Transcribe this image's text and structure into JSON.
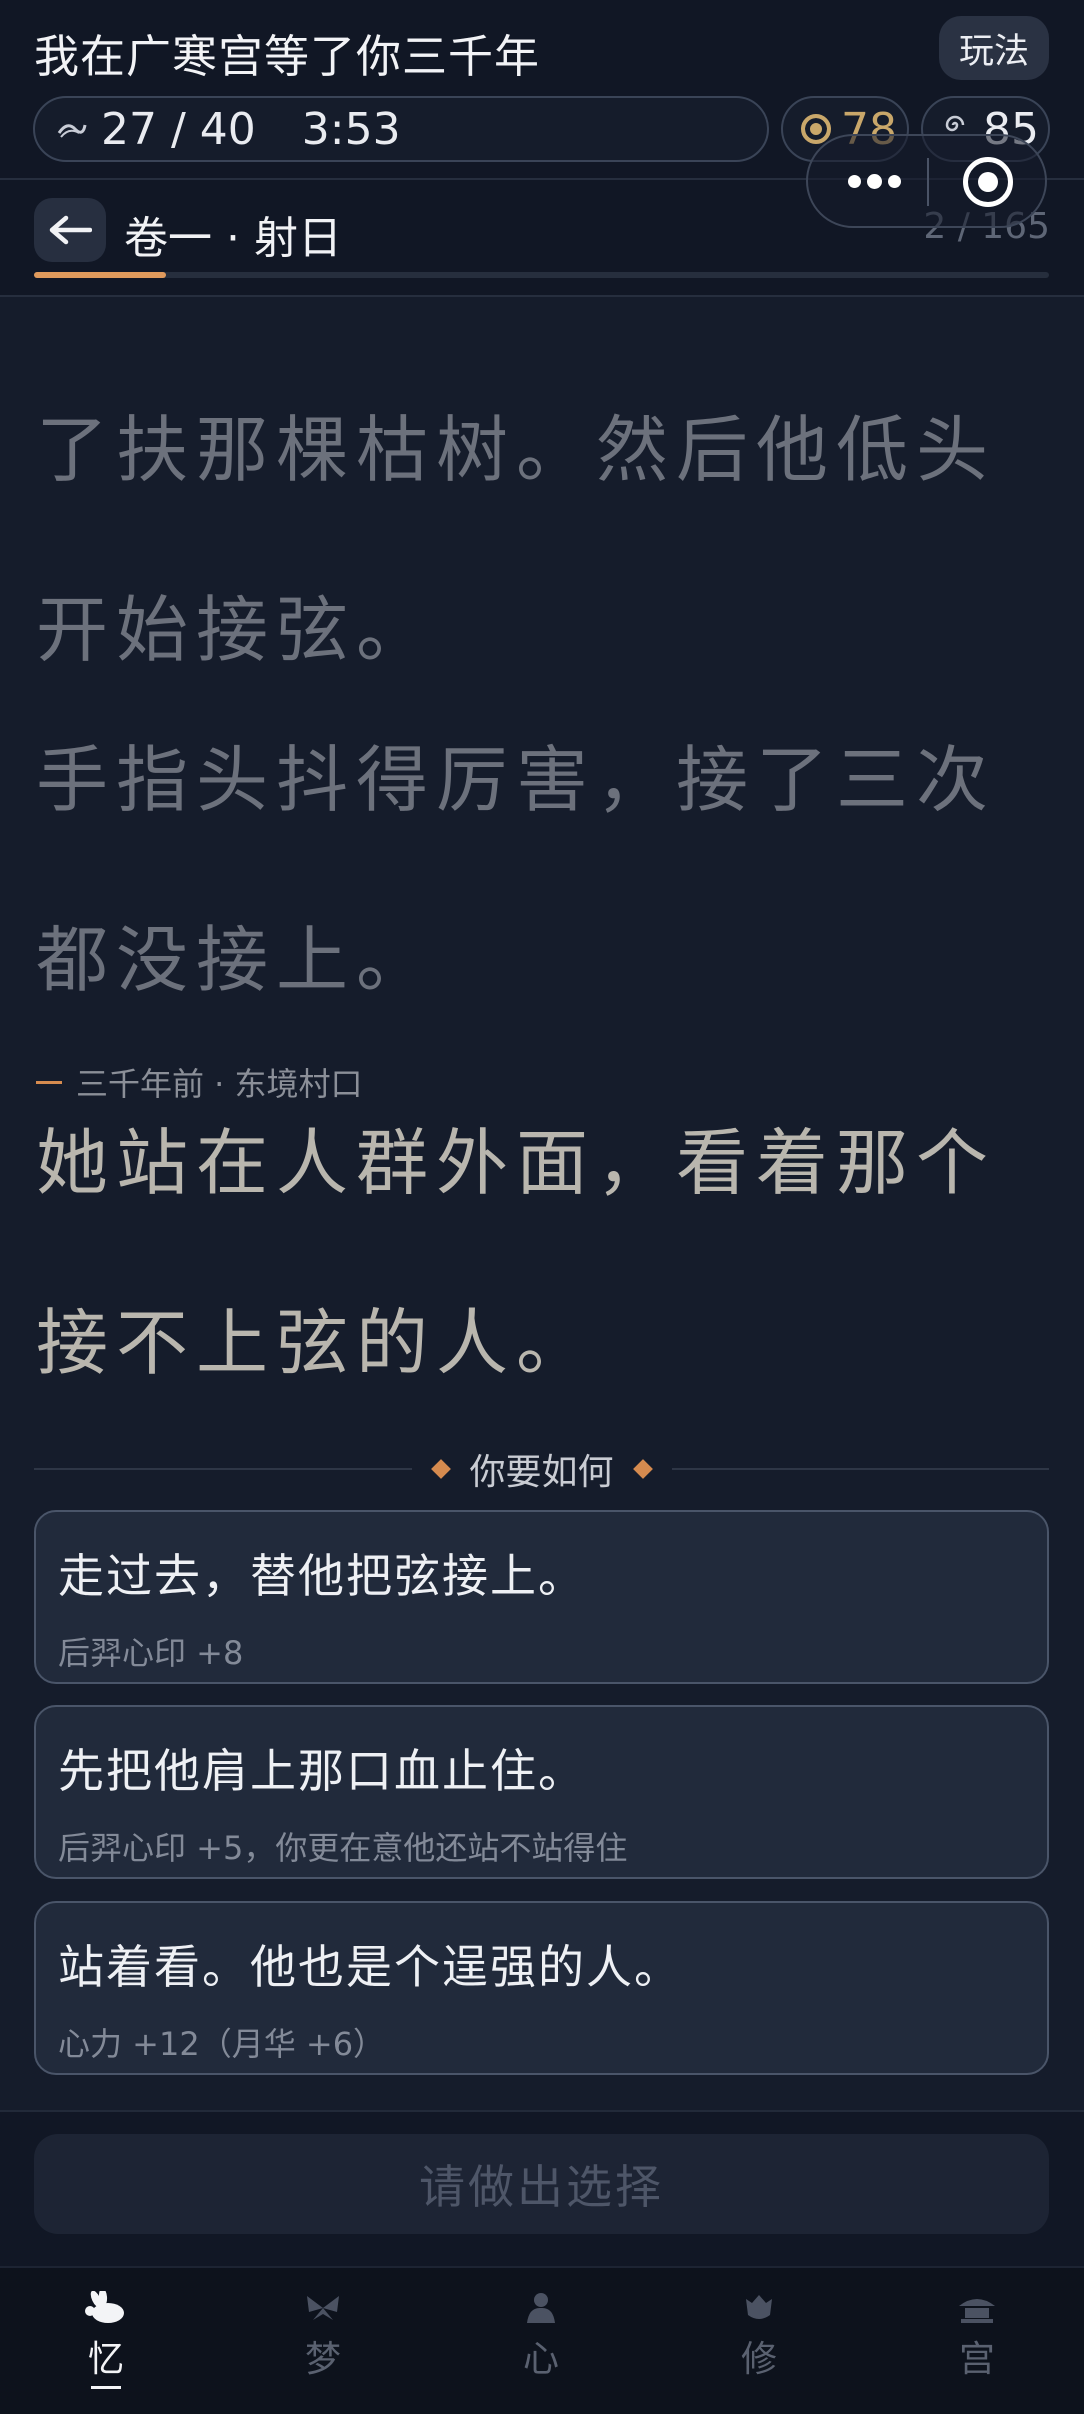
{
  "header": {
    "app_title": "我在广寒宫等了你三千年",
    "rules_label": "玩法",
    "progress": "27 / 40",
    "timer": "3:53",
    "coins": "78",
    "spirit": "85"
  },
  "chapter": {
    "title": "卷一 · 射日",
    "page": "2 / 165",
    "progress_fraction": 0.13
  },
  "story": {
    "para1": "了扶那棵枯树。然后他低头开始接弦。",
    "para2": "手指头抖得厉害，接了三次都没接上。",
    "scene_label": "三千年前 · 东境村口",
    "para3": "她站在人群外面，看着那个接不上弦的人。"
  },
  "choices": {
    "heading": "你要如何",
    "items": [
      {
        "text": "走过去，替他把弦接上。",
        "effect": "后羿心印 +8"
      },
      {
        "text": "先把他肩上那口血止住。",
        "effect": "后羿心印 +5，你更在意他还站不站得住"
      },
      {
        "text": "站着看。他也是个逞强的人。",
        "effect": "心力 +12（月华 +6）"
      }
    ],
    "confirm_label": "请做出选择"
  },
  "tabs": [
    {
      "label": "忆",
      "icon": "rabbit-icon",
      "active": true
    },
    {
      "label": "梦",
      "icon": "butterfly-icon",
      "active": false
    },
    {
      "label": "心",
      "icon": "heart-figure-icon",
      "active": false
    },
    {
      "label": "修",
      "icon": "cauldron-icon",
      "active": false
    },
    {
      "label": "宫",
      "icon": "palace-icon",
      "active": false
    }
  ],
  "colors": {
    "accent": "#e09a5c",
    "background": "#151c2b",
    "coin": "#c9a76a"
  }
}
